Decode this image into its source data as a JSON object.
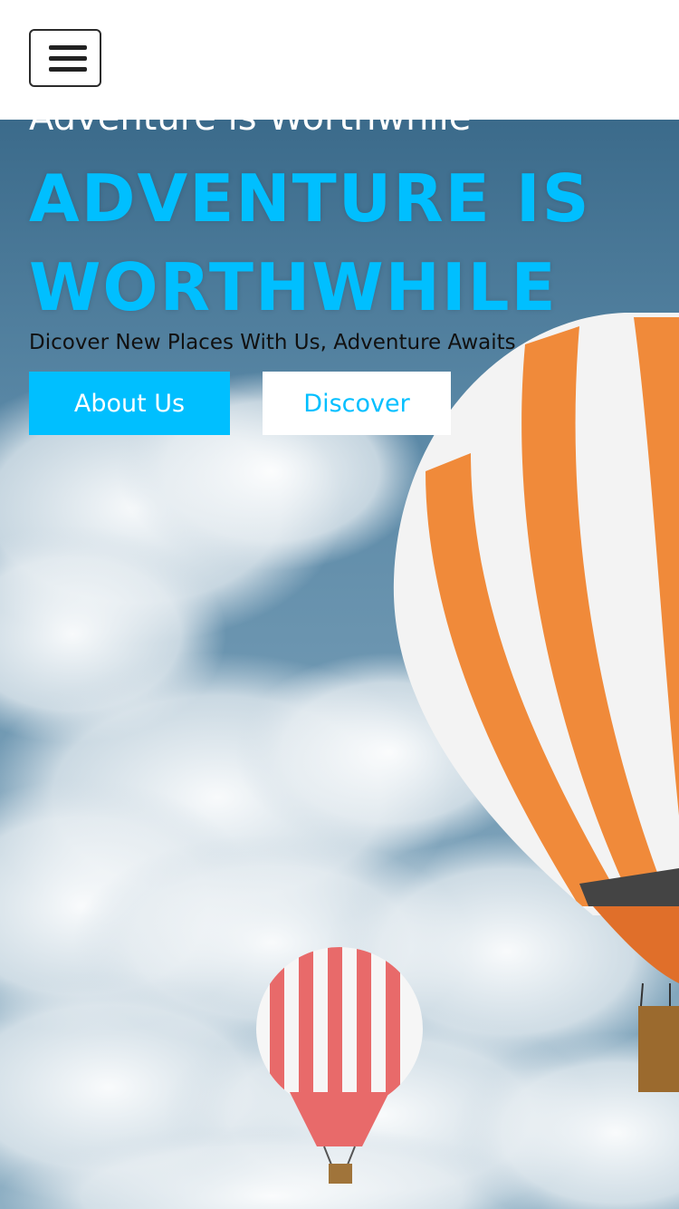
{
  "navbar": {
    "menu_icon": "hamburger-menu-icon"
  },
  "hero": {
    "eyebrow": "Adventure is Worthwhile",
    "headline_line1": "ADVENTURE IS",
    "headline_line2": "WORTHWHILE",
    "tagline": "Dicover New Places With Us, Adventure Awaits",
    "about_button_label": "About Us",
    "discover_button_label": "Discover",
    "background_image": "sky-clouds-hot-air-balloons-image"
  },
  "colors": {
    "accent": "#00bfff",
    "navbar_bg": "#ffffff",
    "balloon_large": "#f08a3a",
    "balloon_small": "#e86a6a"
  }
}
